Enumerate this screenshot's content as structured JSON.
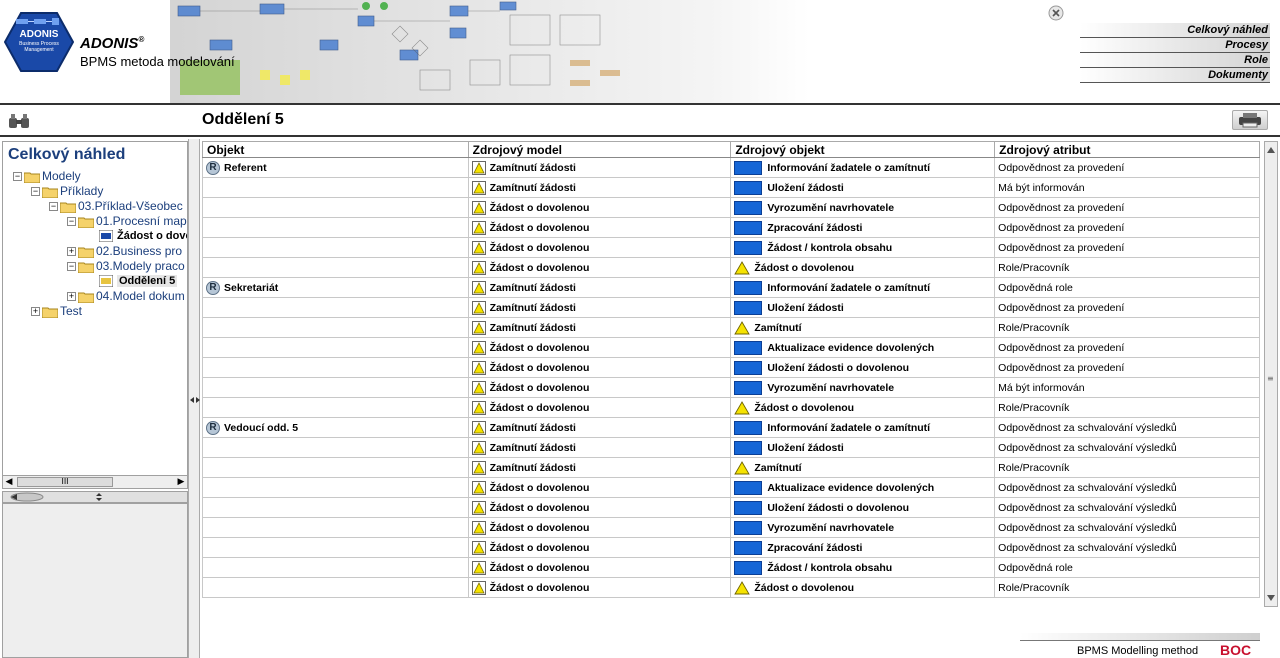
{
  "header": {
    "logo_name": "ADONIS",
    "logo_sub": "Business Process Management",
    "brand": "ADONIS",
    "brand_mark": "®",
    "subtitle": "BPMS metoda modelování",
    "nav": [
      {
        "label": "Celkový náhled"
      },
      {
        "label": "Procesy"
      },
      {
        "label": "Role"
      },
      {
        "label": "Dokumenty"
      }
    ]
  },
  "titlebar": {
    "title": "Oddělení 5"
  },
  "tree": {
    "title": "Celkový náhled",
    "nodes": [
      {
        "label": "Modely",
        "toggle": "−"
      },
      {
        "label": "Příklady",
        "toggle": "−"
      },
      {
        "label": "03.Příklad-Všeobec",
        "toggle": "−"
      },
      {
        "label": "01.Procesní map",
        "toggle": "−"
      },
      {
        "label": "Žádost o dovo"
      },
      {
        "label": "02.Business pro",
        "toggle": "+"
      },
      {
        "label": "03.Modely praco",
        "toggle": "−"
      },
      {
        "label": "Oddělení 5"
      },
      {
        "label": "04.Model dokum",
        "toggle": "+"
      },
      {
        "label": "Test",
        "toggle": "+"
      }
    ],
    "hscroll_grip": "III"
  },
  "table": {
    "headers": [
      "Objekt",
      "Zdrojový model",
      "Zdrojový objekt",
      "Zdrojový atribut"
    ],
    "rows": [
      {
        "object": "Referent",
        "model": "Zamítnutí žádosti",
        "src": "Informování žadatele o zamítnutí",
        "src_type": "activity",
        "attr": "Odpovědnost za provedení"
      },
      {
        "object": "",
        "model": "Zamítnutí žádosti",
        "src": "Uložení žádosti",
        "src_type": "activity",
        "attr": "Má být informován"
      },
      {
        "object": "",
        "model": "Žádost o dovolenou",
        "src": "Vyrozumění navrhovatele",
        "src_type": "activity",
        "attr": "Odpovědnost za provedení"
      },
      {
        "object": "",
        "model": "Žádost o dovolenou",
        "src": "Zpracování žádosti",
        "src_type": "activity",
        "attr": "Odpovědnost za provedení"
      },
      {
        "object": "",
        "model": "Žádost o dovolenou",
        "src": "Žádost / kontrola obsahu",
        "src_type": "activity",
        "attr": "Odpovědnost za provedení"
      },
      {
        "object": "",
        "model": "Žádost o dovolenou",
        "src": "Žádost o dovolenou",
        "src_type": "event",
        "attr": "Role/Pracovník"
      },
      {
        "object": "Sekretariát",
        "model": "Zamítnutí žádosti",
        "src": "Informování žadatele o zamítnutí",
        "src_type": "activity",
        "attr": "Odpovědná role"
      },
      {
        "object": "",
        "model": "Zamítnutí žádosti",
        "src": "Uložení žádosti",
        "src_type": "activity",
        "attr": "Odpovědnost za provedení"
      },
      {
        "object": "",
        "model": "Zamítnutí žádosti",
        "src": "Zamítnutí",
        "src_type": "event",
        "attr": "Role/Pracovník"
      },
      {
        "object": "",
        "model": "Žádost o dovolenou",
        "src": "Aktualizace evidence dovolených",
        "src_type": "activity",
        "attr": "Odpovědnost za provedení"
      },
      {
        "object": "",
        "model": "Žádost o dovolenou",
        "src": "Uložení žádosti o dovolenou",
        "src_type": "activity",
        "attr": "Odpovědnost za provedení"
      },
      {
        "object": "",
        "model": "Žádost o dovolenou",
        "src": "Vyrozumění navrhovatele",
        "src_type": "activity",
        "attr": "Má být informován"
      },
      {
        "object": "",
        "model": "Žádost o dovolenou",
        "src": "Žádost o dovolenou",
        "src_type": "event",
        "attr": "Role/Pracovník"
      },
      {
        "object": "Vedoucí odd. 5",
        "model": "Zamítnutí žádosti",
        "src": "Informování žadatele o zamítnutí",
        "src_type": "activity",
        "attr": "Odpovědnost za schvalování výsledků"
      },
      {
        "object": "",
        "model": "Zamítnutí žádosti",
        "src": "Uložení žádosti",
        "src_type": "activity",
        "attr": "Odpovědnost za schvalování výsledků"
      },
      {
        "object": "",
        "model": "Zamítnutí žádosti",
        "src": "Zamítnutí",
        "src_type": "event",
        "attr": "Role/Pracovník"
      },
      {
        "object": "",
        "model": "Žádost o dovolenou",
        "src": "Aktualizace evidence dovolených",
        "src_type": "activity",
        "attr": "Odpovědnost za schvalování výsledků"
      },
      {
        "object": "",
        "model": "Žádost o dovolenou",
        "src": "Uložení žádosti o dovolenou",
        "src_type": "activity",
        "attr": "Odpovědnost za schvalování výsledků"
      },
      {
        "object": "",
        "model": "Žádost o dovolenou",
        "src": "Vyrozumění navrhovatele",
        "src_type": "activity",
        "attr": "Odpovědnost za schvalování výsledků"
      },
      {
        "object": "",
        "model": "Žádost o dovolenou",
        "src": "Zpracování žádosti",
        "src_type": "activity",
        "attr": "Odpovědnost za schvalování výsledků"
      },
      {
        "object": "",
        "model": "Žádost o dovolenou",
        "src": "Žádost / kontrola obsahu",
        "src_type": "activity",
        "attr": "Odpovědná role"
      },
      {
        "object": "",
        "model": "Žádost o dovolenou",
        "src": "Žádost o dovolenou",
        "src_type": "event",
        "attr": "Role/Pracovník"
      }
    ],
    "role_icon_letter": "R"
  },
  "footer": {
    "text": "BPMS Modelling method",
    "logo": "BOC"
  },
  "icons": {
    "role": "role-circle-icon",
    "model": "process-model-icon",
    "activity": "activity-box-icon",
    "event": "event-triangle-icon",
    "folder": "folder-icon"
  },
  "colors": {
    "activity": "#1566d6",
    "event": "#f5e200",
    "tree_title": "#1c3f7c",
    "footer_logo": "#c8102e"
  }
}
